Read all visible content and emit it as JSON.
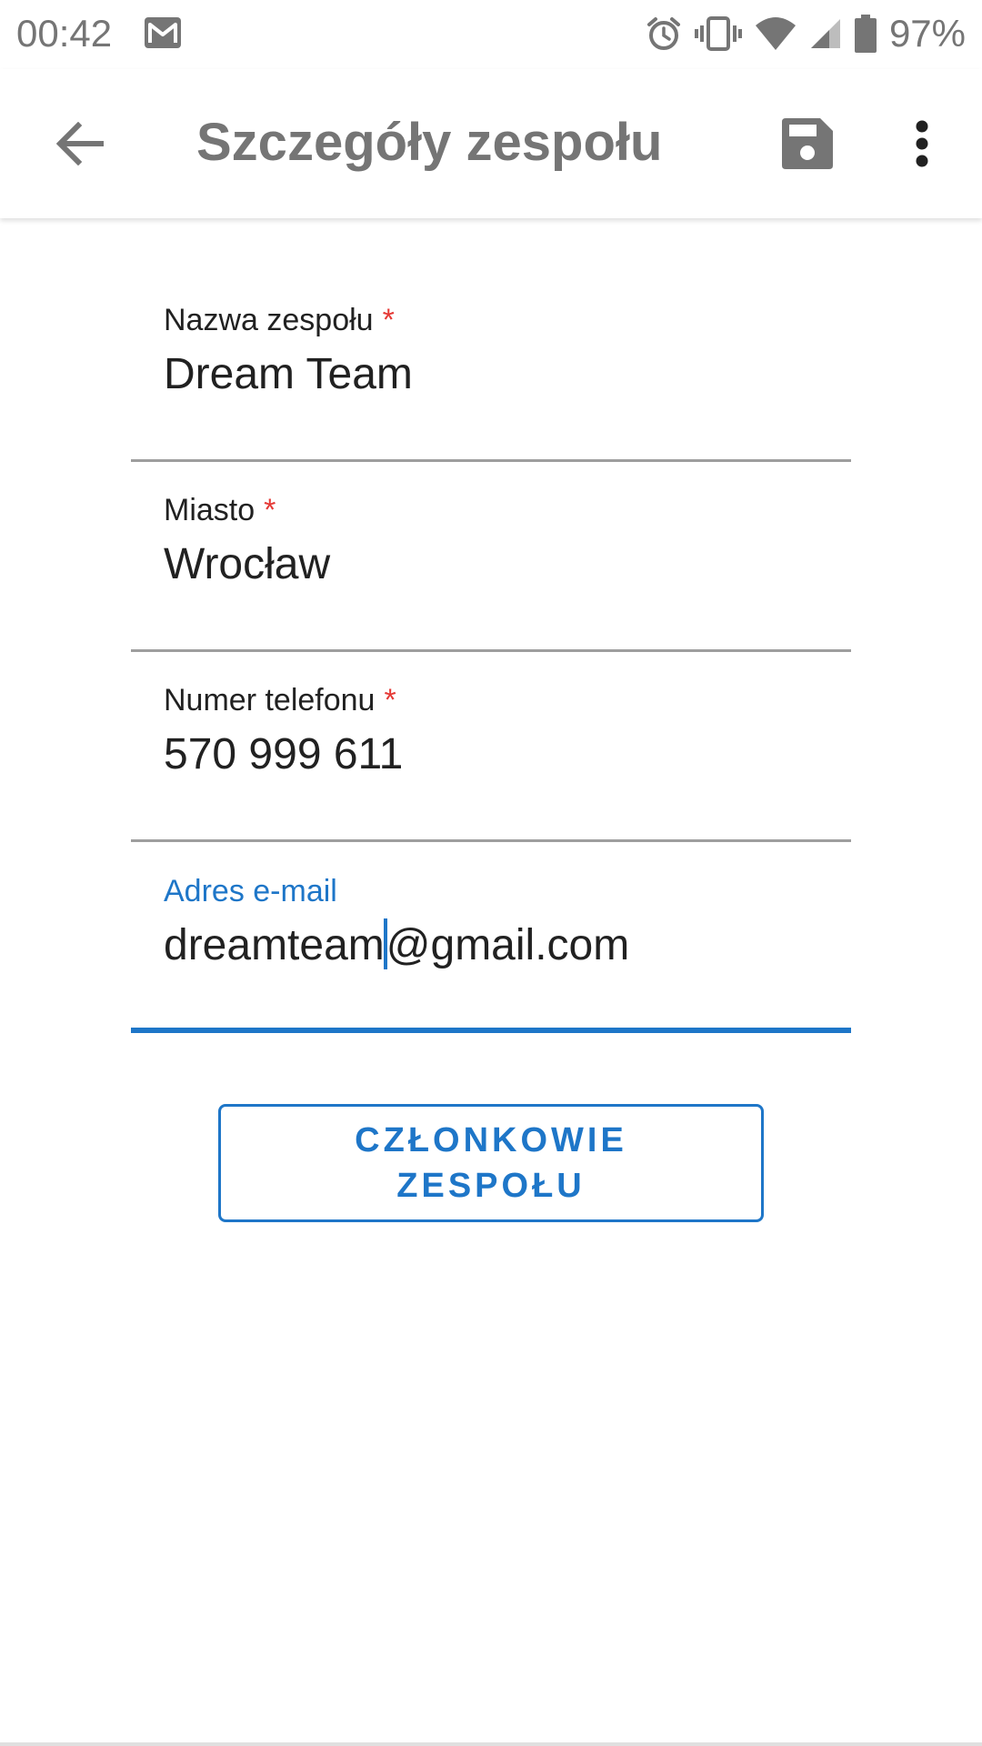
{
  "status_bar": {
    "time": "00:42",
    "battery_percent": "97%",
    "icons": [
      "gmail-icon",
      "alarm-icon",
      "vibrate-icon",
      "wifi-icon",
      "signal-icon",
      "battery-icon"
    ]
  },
  "app_bar": {
    "title": "Szczegóły zespołu",
    "icons": [
      "back-arrow-icon",
      "save-icon",
      "more-vert-icon"
    ]
  },
  "form": {
    "team_name": {
      "label": "Nazwa zespołu",
      "required_mark": "*",
      "value": "Dream Team"
    },
    "city": {
      "label": "Miasto",
      "required_mark": "*",
      "value": "Wrocław"
    },
    "phone": {
      "label": "Numer telefonu",
      "required_mark": "*",
      "value": "570 999 611"
    },
    "email": {
      "label": "Adres e-mail",
      "value_before_caret": "dreamteam",
      "value_after_caret": "@gmail.com"
    }
  },
  "members_button": {
    "label": "CZŁONKOWIE ZESPOŁU"
  },
  "colors": {
    "accent": "#1e76c8",
    "required": "#e53935",
    "text": "#212121",
    "secondary": "#757575",
    "underline": "#9e9e9e"
  }
}
